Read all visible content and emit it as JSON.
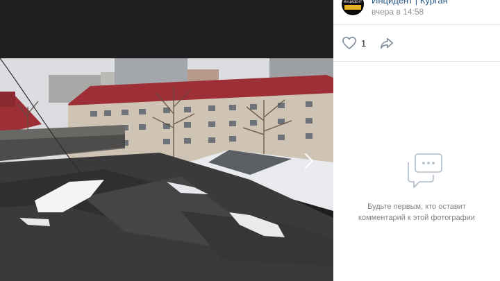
{
  "post": {
    "author": "Инцидент | Курган",
    "time": "вчера в 14:58",
    "avatar_text": "ИНЦИДЕНТ"
  },
  "actions": {
    "likes": "1",
    "like_icon": "heart-icon",
    "share_icon": "share-arrow-icon"
  },
  "comments": {
    "empty_line1": "Будьте первым, кто оставит",
    "empty_line2": "комментарий к этой фотографии",
    "icon": "comments-icon"
  },
  "viewer": {
    "next_icon": "chevron-right-icon",
    "photo_alt": "damaged roof photo"
  },
  "colors": {
    "link": "#2a5885",
    "muted": "#939393",
    "empty_text": "#828282",
    "icon": "#99a2ad"
  }
}
